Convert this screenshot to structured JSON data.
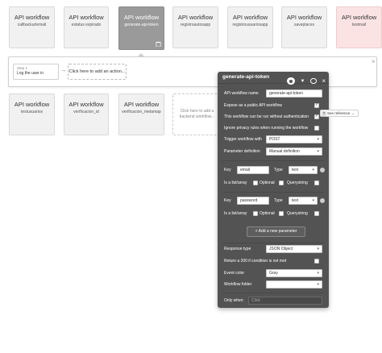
{
  "workflows_top": [
    {
      "title": "API workflow",
      "subtitle": "callbackurlemail"
    },
    {
      "title": "API workflow",
      "subtitle": "estatus expirado"
    },
    {
      "title": "API workflow",
      "subtitle": "generate-api-token"
    },
    {
      "title": "API workflow",
      "subtitle": "registroautosapp"
    },
    {
      "title": "API workflow",
      "subtitle": "registrousuariosapp"
    },
    {
      "title": "API workflow",
      "subtitle": "saveplaces"
    },
    {
      "title": "API workflow",
      "subtitle": "testmail"
    }
  ],
  "workflows_bottom": [
    {
      "title": "API workflow",
      "subtitle": "testusuarios"
    },
    {
      "title": "API workflow",
      "subtitle": "verificacion_id"
    },
    {
      "title": "API workflow",
      "subtitle": "verificacion_metamap"
    }
  ],
  "empty_card": {
    "line1": "Click here to add a",
    "line2": "backend workflow..."
  },
  "action_strip": {
    "step_number": "Step 1",
    "step_label": "Log the user in",
    "arrow": "→",
    "add_action": "Click here to add an action...",
    "close": "×"
  },
  "canvas_close": "×",
  "panel": {
    "title": "generate-api-token",
    "name_label": "API workflow name",
    "name_value": "generate-api-token",
    "expose_label": "Expose as a public API workflow",
    "no_auth_label": "This workflow can be run without authentication",
    "ignore_privacy_label": "Ignore privacy rules when running the workflow",
    "trigger_label": "Trigger workflow with",
    "trigger_value": "POST",
    "param_def_label": "Parameter definition",
    "param_def_value": "Manual definition",
    "params": [
      {
        "key_label": "Key",
        "key_value": "email",
        "type_label": "Type",
        "type_value": "text",
        "list_label": "Is a list/array",
        "optional_label": "Optional",
        "query_label": "Querystring"
      },
      {
        "key_label": "Key",
        "key_value": "password",
        "type_label": "Type",
        "type_value": "text",
        "list_label": "Is a list/array",
        "optional_label": "Optional",
        "query_label": "Querystring"
      }
    ],
    "add_param_label": "Add a new parameter",
    "response_type_label": "Response type",
    "response_type_value": "JSON Object",
    "return_200_label": "Return a 200 if condition is not met",
    "event_color_label": "Event color",
    "event_color_value": "Gray",
    "folder_label": "Workflow folder",
    "folder_value": "",
    "only_when_label": "Only when",
    "only_when_placeholder": "Click"
  },
  "tooltip": {
    "mark": "?",
    "text": "See reference →"
  },
  "colors": {
    "panel_bg": "#535353",
    "card_bg": "#f1f1f1",
    "selected_card": "#9a9a9a",
    "pink_card": "#fbe3e3"
  }
}
